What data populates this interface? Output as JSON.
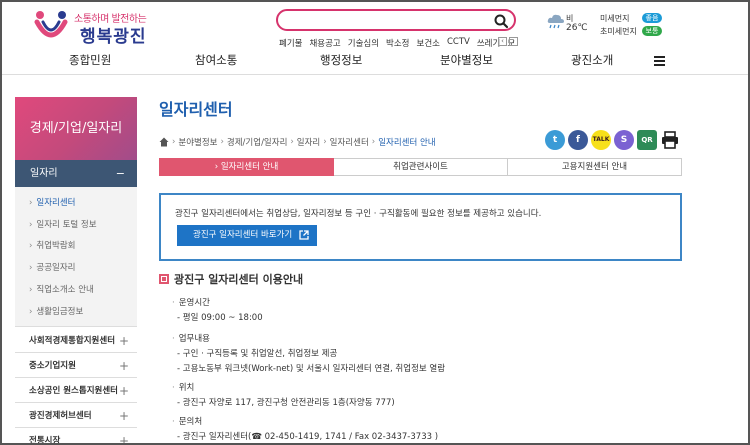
{
  "header": {
    "logo_top": "소통하며 발전하는",
    "logo_main": "행복광진",
    "search": {
      "value": "",
      "placeholder": ""
    },
    "keywords": [
      "폐기물",
      "채용공고",
      "기술심의",
      "박소정",
      "보건소",
      "CCTV",
      "쓰레기",
      "모"
    ],
    "weather": {
      "condition": "비",
      "temperature": "26℃",
      "fine_dust_label": "미세먼지",
      "fine_dust_status": "좋음",
      "fine_dust_color": "#1b9bd7",
      "ultra_dust_label": "초미세먼지",
      "ultra_dust_status": "보통",
      "ultra_dust_color": "#30a84a"
    }
  },
  "gnb": [
    "종합민원",
    "참여소통",
    "행정정보",
    "분야별정보",
    "광진소개"
  ],
  "sidebar": {
    "title": "경제/기업/일자리",
    "category": "일자리",
    "category_toggle": "−",
    "sub_items": [
      "일자리센터",
      "일자리 토털 정보",
      "취업박람회",
      "공공일자리",
      "직업소개소 안내",
      "생활임금정보"
    ],
    "rows": [
      "사회적경제통합지원센터",
      "중소기업지원",
      "소상공인 원스톱지원센터",
      "광진경제허브센터",
      "전통시장"
    ],
    "plus": "+"
  },
  "content": {
    "title": "일자리센터",
    "breadcrumb": [
      "분야별정보",
      "경제/기업/일자리",
      "일자리",
      "일자리센터",
      "일자리센터 안내"
    ],
    "share": {
      "twitter": "t",
      "facebook": "f",
      "kakaotalk": "TALK",
      "kakaostory": "S",
      "qr": "QR"
    },
    "tabs": [
      "› 일자리센터 안내",
      "취업관련사이트",
      "고용지원센터 안내"
    ],
    "intro_text": "광진구 일자리센터에서는 취업상담, 일자리정보 등 구인 · 구직활동에 필요한 정보를 제공하고 있습니다.",
    "intro_button": "광진구 일자리센터 바로가기",
    "section_title": "광진구 일자리센터 이용안내",
    "info": [
      {
        "head": "운영시간",
        "lines": [
          "- 평일 09:00 ~ 18:00"
        ]
      },
      {
        "head": "업무내용",
        "lines": [
          "- 구인 · 구직등록 및 취업알선, 취업정보 제공",
          "- 고용노동부 워크넷(Work-net) 및 서울시 일자리센터 연결, 취업정보 열람"
        ]
      },
      {
        "head": "위치",
        "lines": [
          "- 광진구 자양로 117, 광진구청 안전관리동 1층(자양동 777)"
        ]
      },
      {
        "head": "문의처",
        "lines": [
          "- 광진구 일자리센터(☎ 02-450-1419, 1741 / Fax 02-3437-3733 )"
        ]
      }
    ]
  }
}
